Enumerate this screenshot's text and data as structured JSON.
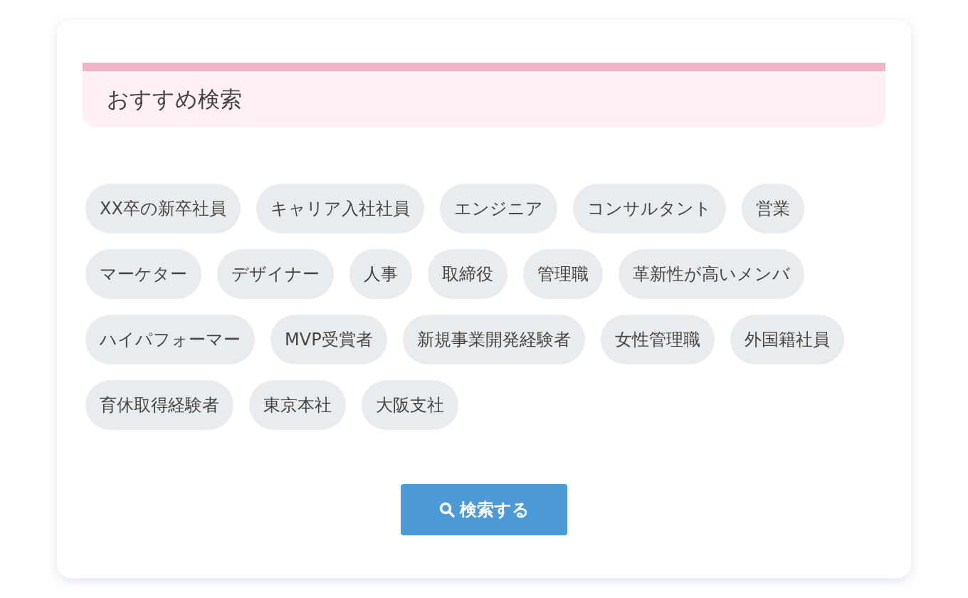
{
  "section": {
    "title": "おすすめ検索"
  },
  "tags": [
    "XX卒の新卒社員",
    "キャリア入社社員",
    "エンジニア",
    "コンサルタント",
    "営業",
    "マーケター",
    "デザイナー",
    "人事",
    "取締役",
    "管理職",
    "革新性が高いメンバ",
    "ハイパフォーマー",
    "MVP受賞者",
    "新規事業開発経験者",
    "女性管理職",
    "外国籍社員",
    "育休取得経験者",
    "東京本社",
    "大阪支社"
  ],
  "search_button": {
    "label": "検索する"
  }
}
